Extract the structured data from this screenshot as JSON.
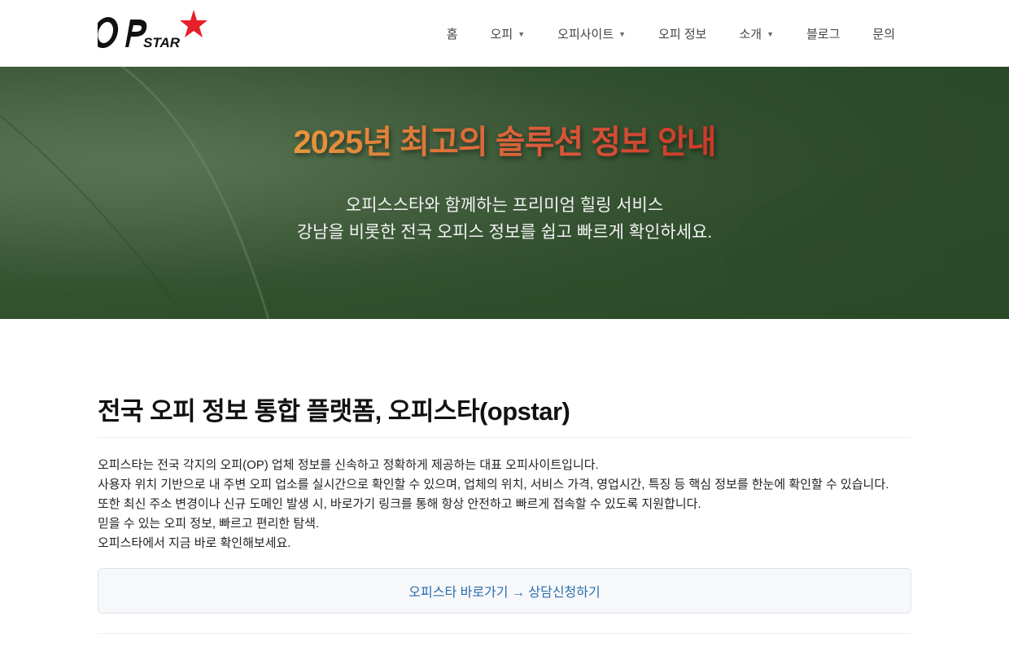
{
  "header": {
    "logo_text": "OPSTAR",
    "nav": [
      {
        "label": "홈",
        "has_dropdown": false
      },
      {
        "label": "오피",
        "has_dropdown": true
      },
      {
        "label": "오피사이트",
        "has_dropdown": true
      },
      {
        "label": "오피 정보",
        "has_dropdown": false
      },
      {
        "label": "소개",
        "has_dropdown": true
      },
      {
        "label": "블로그",
        "has_dropdown": false
      },
      {
        "label": "문의",
        "has_dropdown": false
      }
    ],
    "dropdown_caret": "▼"
  },
  "hero": {
    "title": "2025년 최고의 솔루션 정보 안내",
    "subtitle_line1": "오피스스타와 함께하는 프리미엄 힐링 서비스",
    "subtitle_line2": "강남을 비롯한 전국 오피스 정보를 쉽고 빠르게 확인하세요."
  },
  "main": {
    "title": "전국 오피 정보 통합 플랫폼, 오피스타(opstar)",
    "paragraph_lines": [
      "오피스타는 전국 각지의 오피(OP) 업체 정보를 신속하고 정확하게 제공하는 대표 오피사이트입니다.",
      "사용자 위치 기반으로 내 주변 오피 업소를 실시간으로 확인할 수 있으며, 업체의 위치, 서비스 가격, 영업시간, 특징 등 핵심 정보를 한눈에 확인할 수 있습니다.",
      "또한 최신 주소 변경이나 신규 도메인 발생 시, 바로가기 링크를 통해 항상 안전하고 빠르게 접속할 수 있도록 지원합니다.",
      "믿을 수 있는 오피 정보, 빠르고 편리한 탐색.",
      "오피스타에서 지금 바로 확인해보세요."
    ],
    "cta_label": "오피스타 바로가기 → 상담신청하기"
  },
  "colors": {
    "link": "#2a6fb0",
    "hero_green": "#33532f",
    "logo_star": "#e5202a"
  }
}
